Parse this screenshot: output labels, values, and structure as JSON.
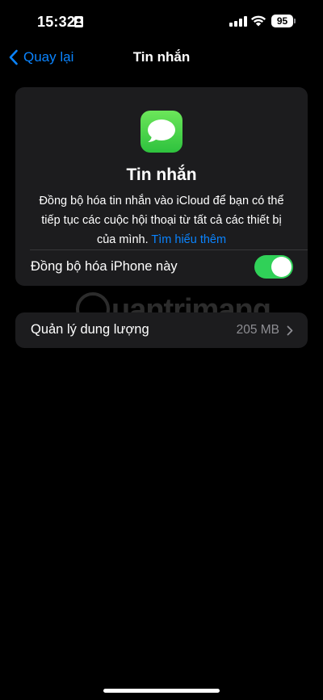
{
  "status_bar": {
    "time": "15:32",
    "battery_level": "95",
    "icons": [
      "id-card-icon",
      "cellular-signal-icon",
      "wifi-icon",
      "battery-icon"
    ]
  },
  "nav": {
    "back_label": "Quay lại",
    "title": "Tin nhắn",
    "back_icon": "chevron-left-icon"
  },
  "app_card": {
    "icon": "messages-app-icon",
    "title": "Tin nhắn",
    "description": "Đồng bộ hóa tin nhắn vào iCloud để bạn có thể tiếp tục các cuộc hội thoại từ tất cả các thiết bị của mình.",
    "learn_more": "Tìm hiểu thêm",
    "sync_label": "Đồng bộ hóa iPhone này",
    "sync_enabled": true
  },
  "storage": {
    "label": "Quản lý dung lượng",
    "value": "205 MB",
    "icon": "chevron-right-icon"
  },
  "watermark": {
    "text": "uantrimang"
  },
  "colors": {
    "background": "#000000",
    "card": "#1c1c1e",
    "accent_blue": "#0a84ff",
    "toggle_green": "#30d158",
    "secondary_text": "#8e8e93"
  }
}
